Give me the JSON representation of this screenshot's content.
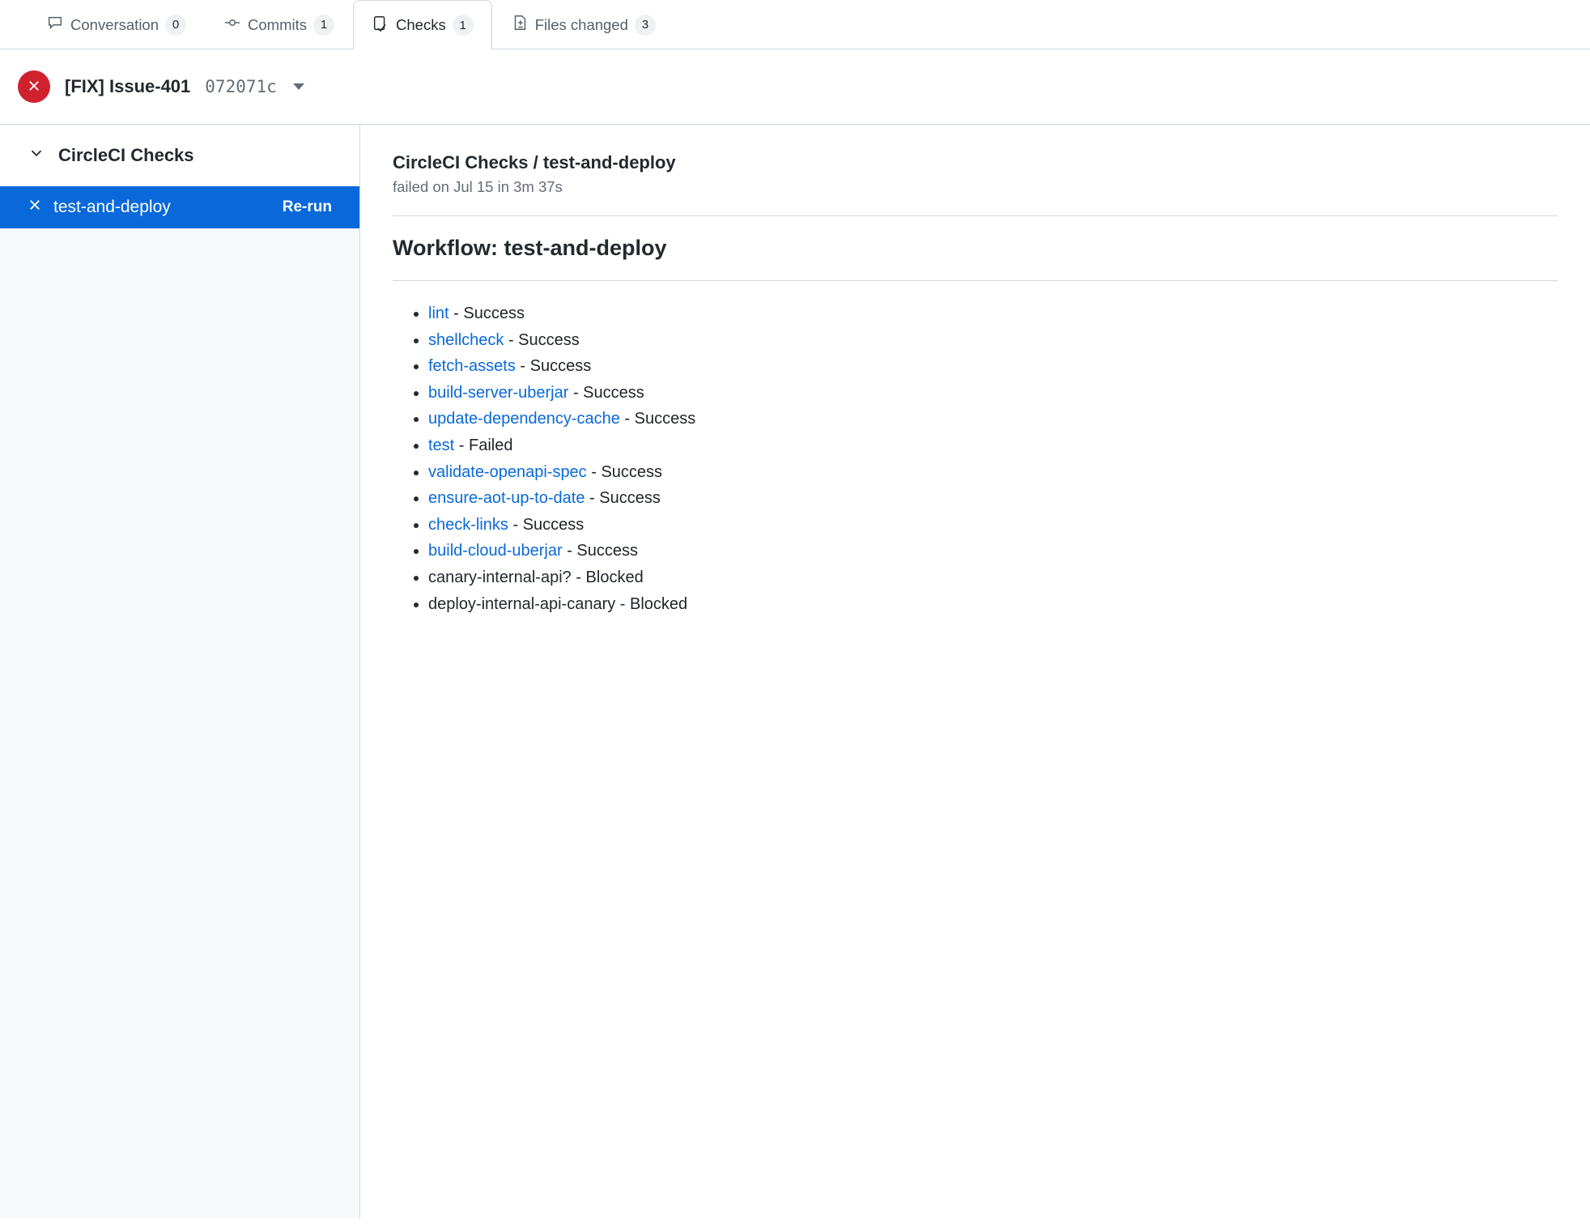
{
  "tabs": {
    "conversation": {
      "label": "Conversation",
      "count": "0"
    },
    "commits": {
      "label": "Commits",
      "count": "1"
    },
    "checks": {
      "label": "Checks",
      "count": "1"
    },
    "files_changed": {
      "label": "Files changed",
      "count": "3"
    }
  },
  "pr": {
    "title": "[FIX] Issue-401",
    "commit_sha": "072071c"
  },
  "sidebar": {
    "suite_name": "CircleCI Checks",
    "check_name": "test-and-deploy",
    "rerun_label": "Re-run"
  },
  "detail": {
    "title": "CircleCI Checks / test-and-deploy",
    "subtitle": "failed on Jul 15 in 3m 37s",
    "workflow_heading": "Workflow: test-and-deploy",
    "jobs": [
      {
        "name": "lint",
        "status": "Success",
        "link": true
      },
      {
        "name": "shellcheck",
        "status": "Success",
        "link": true
      },
      {
        "name": "fetch-assets",
        "status": "Success",
        "link": true
      },
      {
        "name": "build-server-uberjar",
        "status": "Success",
        "link": true
      },
      {
        "name": "update-dependency-cache",
        "status": "Success",
        "link": true
      },
      {
        "name": "test",
        "status": "Failed",
        "link": true
      },
      {
        "name": "validate-openapi-spec",
        "status": "Success",
        "link": true
      },
      {
        "name": "ensure-aot-up-to-date",
        "status": "Success",
        "link": true
      },
      {
        "name": "check-links",
        "status": "Success",
        "link": true
      },
      {
        "name": "build-cloud-uberjar",
        "status": "Success",
        "link": true
      },
      {
        "name": "canary-internal-api?",
        "status": "Blocked",
        "link": false
      },
      {
        "name": "deploy-internal-api-canary",
        "status": "Blocked",
        "link": false
      }
    ]
  }
}
